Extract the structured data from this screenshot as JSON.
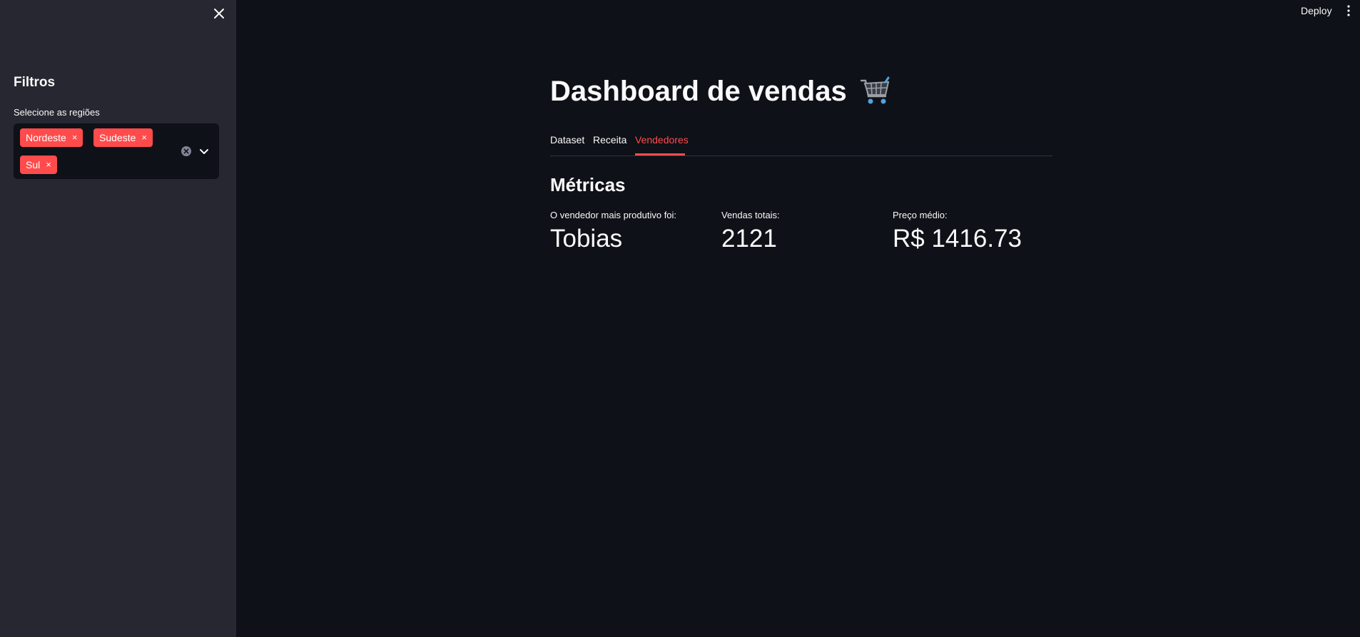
{
  "sidebar": {
    "title": "Filtros",
    "select_label": "Selecione as regiões",
    "selected_regions": [
      "Nordeste",
      "Sudeste",
      "Sul"
    ],
    "chip_remove_glyph": "×"
  },
  "header": {
    "deploy_label": "Deploy"
  },
  "main": {
    "title": "Dashboard de vendas",
    "title_icon": "shopping-cart-icon",
    "tabs": [
      {
        "label": "Dataset",
        "active": false
      },
      {
        "label": "Receita",
        "active": false
      },
      {
        "label": "Vendedores",
        "active": true
      }
    ],
    "section_title": "Métricas",
    "metrics": [
      {
        "label": "O vendedor mais produtivo foi:",
        "value": "Tobias"
      },
      {
        "label": "Vendas totais:",
        "value": "2121"
      },
      {
        "label": "Preço médio:",
        "value": "R$ 1416.73"
      }
    ]
  },
  "colors": {
    "background": "#0e1117",
    "sidebar": "#262730",
    "accent": "#ff4b4b",
    "text": "#fafafa"
  }
}
